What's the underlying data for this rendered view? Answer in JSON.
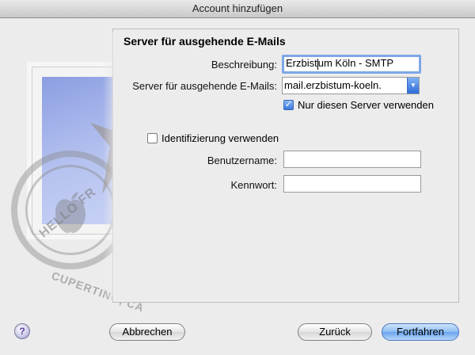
{
  "window": {
    "title": "Account hinzufügen"
  },
  "stamp": {
    "text_top": "HELLO FR",
    "text_bottom": "CUPERTINO, CA"
  },
  "form": {
    "section_title": "Server für ausgehende E-Mails",
    "description_label": "Beschreibung:",
    "description_value_a": "Erzbist",
    "description_value_b": "um Köln - SMTP",
    "server_label": "Server für ausgehende E-Mails:",
    "server_value": "mail.erzbistum-koeln.",
    "only_server_label": "Nur diesen Server verwenden",
    "only_server_checked": true,
    "auth_label": "Identifizierung verwenden",
    "auth_checked": false,
    "username_label": "Benutzername:",
    "username_value": "",
    "password_label": "Kennwort:",
    "password_value": ""
  },
  "footer": {
    "help_label": "?",
    "cancel_label": "Abbrechen",
    "back_label": "Zurück",
    "continue_label": "Fortfahren"
  },
  "colors": {
    "accent": "#3c78dd",
    "focus_ring": "#7da7e6"
  }
}
